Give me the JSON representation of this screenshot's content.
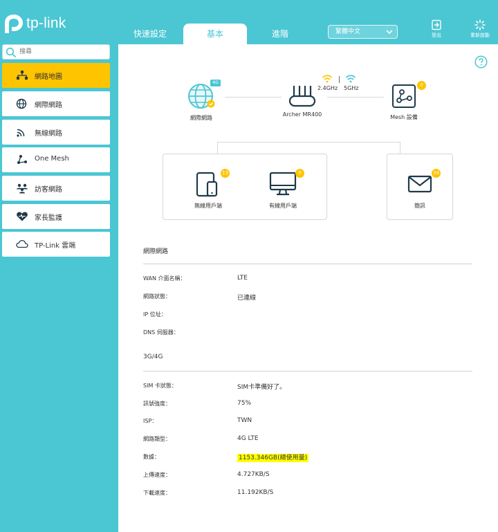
{
  "header": {
    "logo_text": "tp-link",
    "tabs": [
      "快速設定",
      "基本",
      "進階"
    ],
    "language": "繁體中文",
    "logout_label": "登出",
    "reboot_label": "重新啟動"
  },
  "sidebar": {
    "search_placeholder": "搜尋",
    "items": [
      {
        "label": "網路地圖",
        "icon": "network-map-icon"
      },
      {
        "label": "網際網路",
        "icon": "globe-icon"
      },
      {
        "label": "無線網路",
        "icon": "wireless-icon"
      },
      {
        "label": "One Mesh",
        "icon": "mesh-icon"
      },
      {
        "label": "訪客網路",
        "icon": "guest-icon"
      },
      {
        "label": "家長監護",
        "icon": "heart-icon"
      },
      {
        "label": "TP-Link 雲端",
        "icon": "cloud-icon"
      }
    ]
  },
  "map": {
    "internet_label": "網際網路",
    "internet_badge": "4G",
    "router_label": "Archer MR400",
    "band_24": "2.4GHz",
    "band_5": "5GHz",
    "mesh_label": "Mesh 設備",
    "mesh_count": "0",
    "wireless_clients_label": "無線用戶端",
    "wireless_clients_count": "13",
    "wired_clients_label": "有線用戶端",
    "wired_clients_count": "0",
    "sms_label": "簡訊",
    "sms_count": "34"
  },
  "internet_section": {
    "title": "網際網路",
    "rows": [
      {
        "key": "WAN 介面名稱：",
        "value": "LTE"
      },
      {
        "key": "網路狀態：",
        "value": "已連線"
      },
      {
        "key": "IP 位址：",
        "value": ""
      },
      {
        "key": "DNS 伺服器：",
        "value": ""
      }
    ]
  },
  "cellular_section": {
    "title": "3G/4G",
    "rows": [
      {
        "key": "SIM 卡狀態：",
        "value": "SIM卡準備好了。"
      },
      {
        "key": "訊號強度：",
        "value": "75%"
      },
      {
        "key": "ISP：",
        "value": "TWN"
      },
      {
        "key": "網路類型：",
        "value": "4G LTE"
      },
      {
        "key": "數據：",
        "value": "1153.346GB(總使用量)",
        "highlight": true
      },
      {
        "key": "上傳速度：",
        "value": "4.727KB/S"
      },
      {
        "key": "下載速度：",
        "value": "11.192KB/S"
      }
    ]
  },
  "colors": {
    "teal": "#4bc6d3",
    "active_yellow": "#ffc400",
    "highlight": "#ffff00",
    "icon_dark": "#1e3a4a"
  }
}
